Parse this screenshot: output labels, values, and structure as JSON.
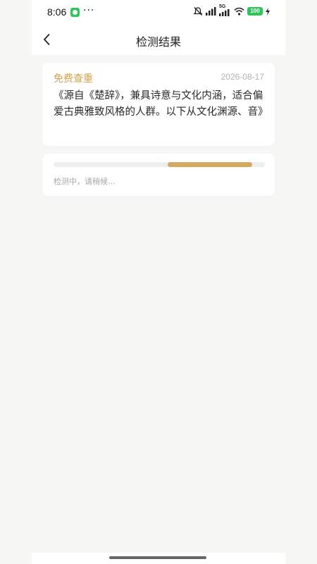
{
  "status_bar": {
    "time": "8:06",
    "more": "···",
    "network": "5G",
    "battery": "100"
  },
  "header": {
    "title": "检测结果"
  },
  "result": {
    "tag": "免费查重",
    "date": "2026-08-17",
    "content": "《源自《楚辞》，兼具诗意与文化内涵，适合偏爱古典雅致风格的人群。以下从文化渊源、音》"
  },
  "progress": {
    "text": "检测中，请稍候...",
    "segment_start": 0.54,
    "segment_end": 0.94
  },
  "colors": {
    "accent": "#d4a34a",
    "progress_fill": "#d3aa61",
    "background": "#f7f7f5"
  }
}
